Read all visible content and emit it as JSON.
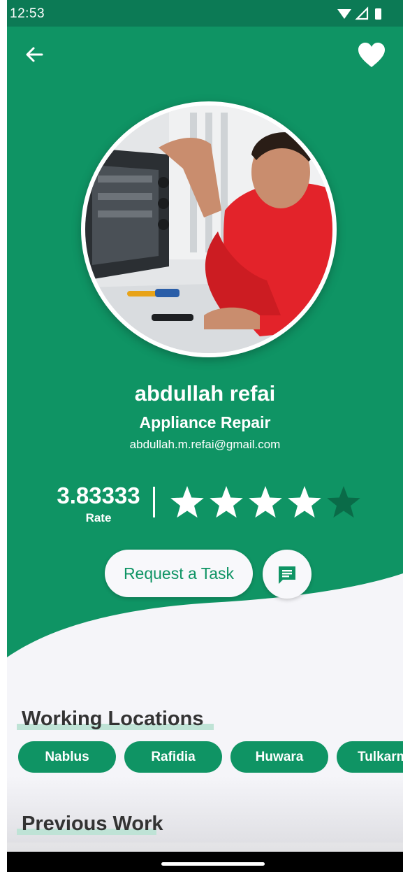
{
  "status_bar": {
    "time": "12:53"
  },
  "profile": {
    "name": "abdullah refai",
    "profession": "Appliance Repair",
    "email": "abdullah.m.refai@gmail.com",
    "avatar_description": "photo of a man in a red shirt repairing an oven",
    "rating_value": "3.83333",
    "rating_caption": "Rate",
    "stars": {
      "filled": 4,
      "total": 5,
      "filled_color": "#ffffff",
      "empty_color": "#0a6b48"
    }
  },
  "actions": {
    "request_label": "Request a Task",
    "chat_icon": "message-icon",
    "back_icon": "arrow-back-icon",
    "favorite_icon": "heart-icon"
  },
  "sections": {
    "locations_title": "Working Locations",
    "locations": [
      "Nablus",
      "Rafidia",
      "Huwara",
      "Tulkarm"
    ],
    "previous_work_title": "Previous Work"
  },
  "colors": {
    "primary_green": "#0f9464",
    "status_green": "#0c7a55",
    "background": "#f5f5f9",
    "title_text": "#333333"
  }
}
